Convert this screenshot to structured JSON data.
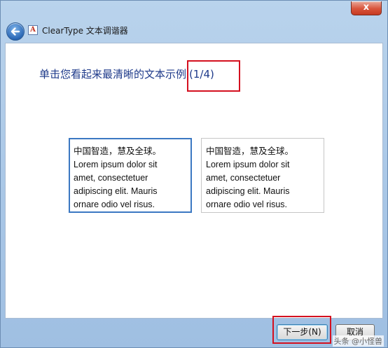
{
  "window": {
    "title": "ClearType 文本调谐器",
    "close_label": "x",
    "app_icon_letter": "A"
  },
  "main": {
    "heading": "单击您看起来最清晰的文本示例",
    "step_counter": "(1/4)",
    "samples": [
      {
        "lines": [
          "中国智造，慧及全球。",
          "Lorem ipsum dolor sit",
          "amet, consectetuer",
          "adipiscing elit. Mauris",
          "ornare odio vel risus."
        ],
        "selected": true
      },
      {
        "lines": [
          "中国智造，慧及全球。",
          "Lorem ipsum dolor sit",
          "amet, consectetuer",
          "adipiscing elit. Mauris",
          "ornare odio vel risus."
        ],
        "selected": false
      }
    ]
  },
  "footer": {
    "next_label": "下一步(N)",
    "cancel_label": "取消"
  },
  "watermark": "头条 @小怪兽"
}
